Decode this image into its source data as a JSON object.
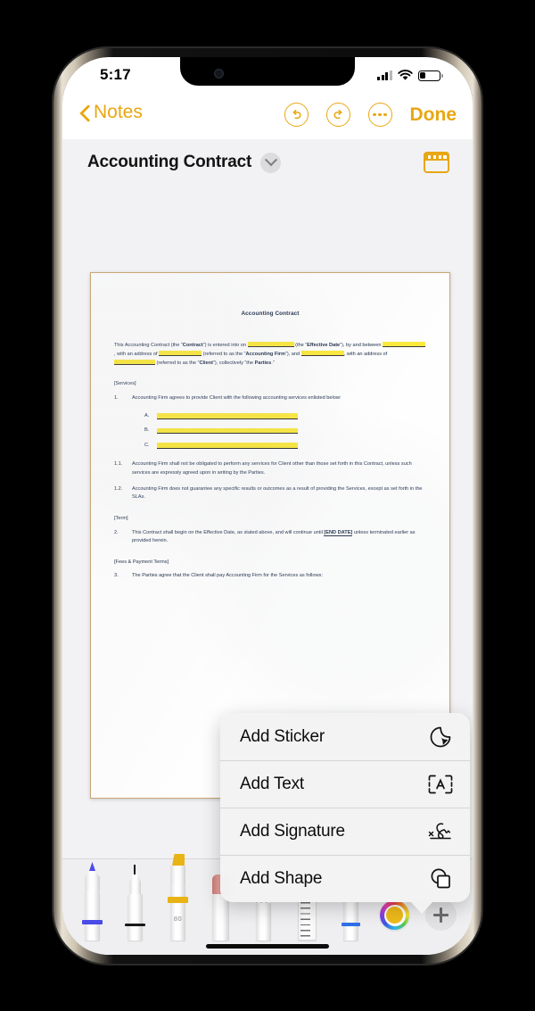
{
  "status_bar": {
    "time": "5:17",
    "cellular_icon": "signal-bars-icon",
    "wifi_icon": "wifi-icon",
    "battery_icon": "battery-icon",
    "battery_level_percent": 26
  },
  "nav_bar": {
    "back_label": "Notes",
    "back_icon": "chevron-left-icon",
    "undo_icon": "undo-icon",
    "redo_icon": "redo-icon",
    "more_icon": "ellipsis-circle-icon",
    "done_label": "Done",
    "accent_color": "#E8A713"
  },
  "doc_header": {
    "title": "Accounting Contract",
    "disclosure_icon": "chevron-down-icon",
    "pages_icon": "page-thumbnails-icon"
  },
  "document": {
    "heading": "Accounting Contract",
    "intro": {
      "seg1": "This Accounting Contract (the “",
      "bold1": "Contract",
      "seg2": "”) is entered into on ",
      "seg3": " (the “",
      "bold2": "Effective Date",
      "seg4": "”), by and between ",
      "seg5": ", with an address of ",
      "seg6": "(referred to as the “",
      "bold3": "Accounting Firm",
      "seg7": "”), and ",
      "seg8": ", with an address of ",
      "seg9": " (referred to as the “",
      "bold4": "Client",
      "seg10": "”), collectively “the ",
      "bold5": "Parties",
      "seg11": ".”"
    },
    "services_tag": "[Services]",
    "clause_1_num": "1.",
    "clause_1_text": "Accounting Firm agrees to provide Client with the following accounting services enlisted below:",
    "service_items": [
      "A.",
      "B.",
      "C."
    ],
    "clause_11_num": "1.1.",
    "clause_11_text": "Accounting Firm shall not be obligated to perform any services for Client other than those set forth in this Contract, unless such services are expressly agreed upon in writing by the Parties.",
    "clause_12_num": "1.2.",
    "clause_12_text": "Accounting Firm does not guarantee any specific results or outcomes as a result of providing the Services, except as set forth in the SLAs.",
    "term_tag": "[Term]",
    "clause_2_num": "2.",
    "clause_2_text_a": "This Contract shall begin on the Effective Date, as stated above, and will continue until ",
    "clause_2_end_date": "[END DATE]",
    "clause_2_text_b": " unless terminated earlier as provided herein.",
    "fees_tag": "[Fees & Payment Terms]",
    "clause_3_num": "3.",
    "clause_3_text": "The Parties agree that the Client shall pay Accounting Firm for the Services as follows:",
    "highlight_color": "#FCE93F"
  },
  "popup_menu": {
    "items": [
      {
        "label": "Add Sticker",
        "icon": "sticker-icon"
      },
      {
        "label": "Add Text",
        "icon": "text-box-icon"
      },
      {
        "label": "Add Signature",
        "icon": "signature-icon"
      },
      {
        "label": "Add Shape",
        "icon": "shapes-icon"
      }
    ]
  },
  "markup_toolbar": {
    "tools": [
      {
        "name": "pen-tool",
        "color": "#4A4AE8",
        "size_label": ""
      },
      {
        "name": "fine-marker-tool",
        "color": "#1A1A1A",
        "size_label": ""
      },
      {
        "name": "highlighter-tool",
        "color": "#E8B314",
        "size_label": "80",
        "selected": true
      },
      {
        "name": "eraser-tool",
        "color": "#D98F8A",
        "size_label": ""
      },
      {
        "name": "smudge-tool",
        "color": "#C8C8C8",
        "size_label": ""
      },
      {
        "name": "ruler-tool",
        "color": "#6D6D6D",
        "size_label": ""
      },
      {
        "name": "pencil-tool",
        "color": "#2F6FE8",
        "size_label": ""
      }
    ],
    "color_picker": {
      "name": "color-wheel",
      "selected_color": "#EFBB1A"
    },
    "add_button": {
      "name": "add-tool-button",
      "icon": "plus-icon"
    }
  }
}
